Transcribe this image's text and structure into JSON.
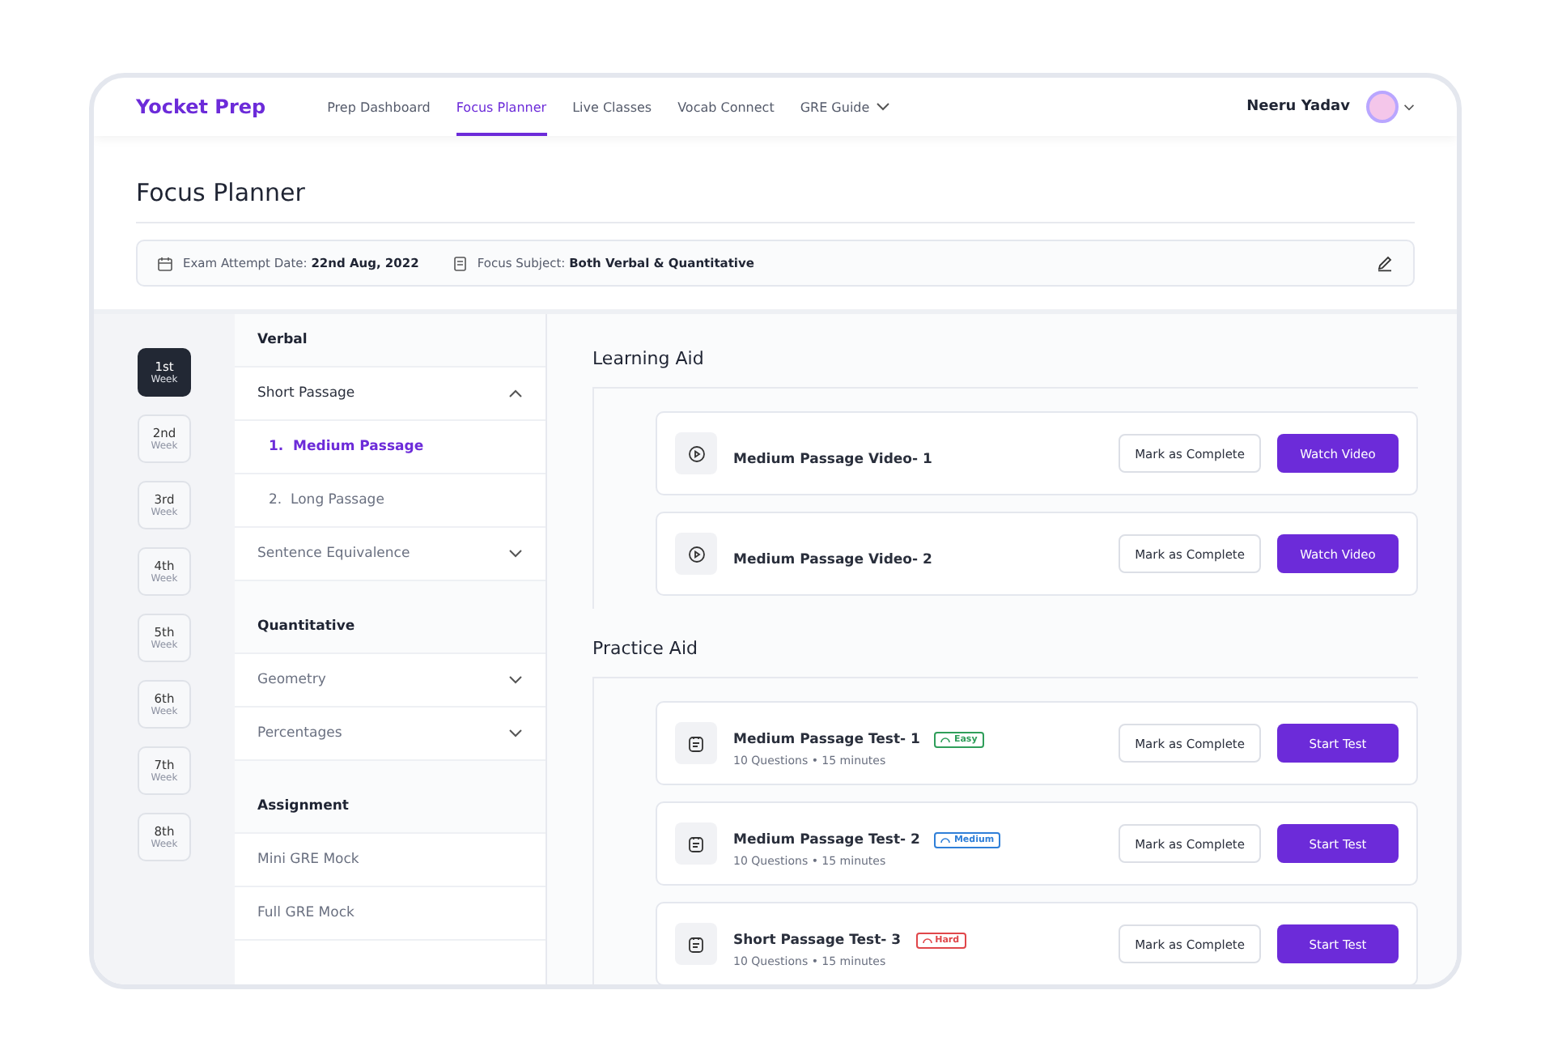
{
  "nav": {
    "logo": "Yocket Prep",
    "links": [
      {
        "label": "Prep Dashboard",
        "selected": false,
        "dropdown": false
      },
      {
        "label": "Focus Planner",
        "selected": true,
        "dropdown": false
      },
      {
        "label": "Live Classes",
        "selected": false,
        "dropdown": false
      },
      {
        "label": "Vocab Connect",
        "selected": false,
        "dropdown": false
      },
      {
        "label": "GRE Guide",
        "selected": false,
        "dropdown": true
      }
    ],
    "user": "Neeru Yadav"
  },
  "page_title": "Focus Planner",
  "info_bar": {
    "exam_label": "Exam Attempt Date:",
    "exam_value": "22nd Aug, 2022",
    "subject_label": "Focus Subject:",
    "subject_value": "Both Verbal & Quantitative"
  },
  "weeks": [
    {
      "label": "1st",
      "sub": "Week",
      "selected": true
    },
    {
      "label": "2nd",
      "sub": "Week",
      "selected": false
    },
    {
      "label": "3rd",
      "sub": "Week",
      "selected": false
    },
    {
      "label": "4th",
      "sub": "Week",
      "selected": false
    },
    {
      "label": "5th",
      "sub": "Week",
      "selected": false
    },
    {
      "label": "6th",
      "sub": "Week",
      "selected": false
    },
    {
      "label": "7th",
      "sub": "Week",
      "selected": false
    },
    {
      "label": "8th",
      "sub": "Week",
      "selected": false
    }
  ],
  "menu": [
    {
      "title": "Verbal",
      "items": [
        {
          "label": "Short Passage",
          "kind": "accordion",
          "expanded": true,
          "children": [
            {
              "label": "1.  Medium Passage",
              "selected": true
            },
            {
              "label": "2.  Long Passage",
              "selected": false
            }
          ]
        },
        {
          "label": "Sentence Equivalence",
          "kind": "accordion",
          "expanded": false
        }
      ]
    },
    {
      "title": "Quantitative",
      "items": [
        {
          "label": "Geometry",
          "kind": "accordion",
          "expanded": false
        },
        {
          "label": "Percentages",
          "kind": "accordion",
          "expanded": false
        }
      ]
    },
    {
      "title": "Assignment",
      "items": [
        {
          "label": "Mini GRE Mock",
          "kind": "link"
        },
        {
          "label": "Full GRE Mock",
          "kind": "link"
        }
      ]
    }
  ],
  "sections": [
    {
      "title": "Learning Aid",
      "cards": [
        {
          "kind": "video",
          "title": "Medium Passage Video- 1",
          "secondary": "Mark as Complete",
          "primary": "Watch Video"
        },
        {
          "kind": "video",
          "title": "Medium Passage Video- 2",
          "secondary": "Mark as Complete",
          "primary": "Watch Video"
        }
      ]
    },
    {
      "title": "Practice Aid",
      "cards": [
        {
          "kind": "test",
          "title": "Medium Passage Test- 1",
          "badge": {
            "label": "Easy",
            "color": "#2f9e5a"
          },
          "meta": "10 Questions • 15 minutes",
          "secondary": "Mark as Complete",
          "primary": "Start Test"
        },
        {
          "kind": "test",
          "title": "Medium Passage Test- 2",
          "badge": {
            "label": "Medium",
            "color": "#2f7fd8"
          },
          "meta": "10 Questions • 15 minutes",
          "secondary": "Mark as Complete",
          "primary": "Start Test"
        },
        {
          "kind": "test",
          "title": "Short Passage Test- 3",
          "badge": {
            "label": "Hard",
            "color": "#e0464a"
          },
          "meta": "10 Questions • 15 minutes",
          "secondary": "Mark as Complete",
          "primary": "Start Test"
        }
      ]
    }
  ]
}
